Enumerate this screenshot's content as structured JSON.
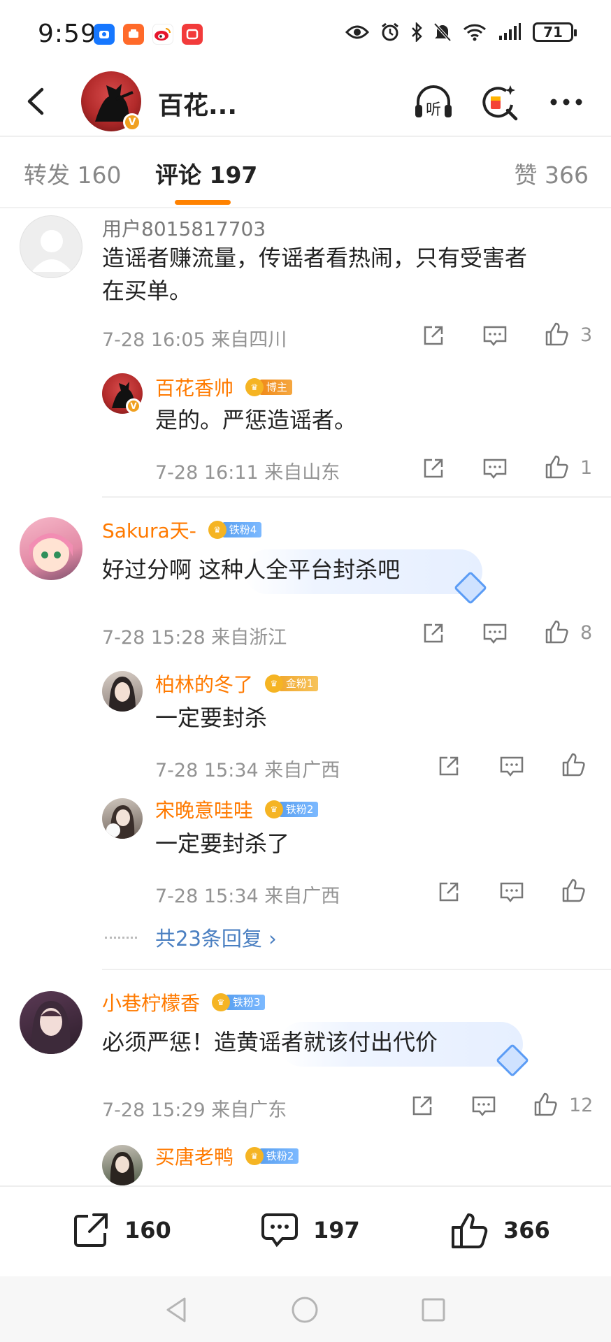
{
  "status_bar": {
    "time": "9:59",
    "battery": "71",
    "app_icons": [
      "app-icon-blue",
      "app-icon-orange",
      "weibo-icon",
      "app-icon-red"
    ],
    "indicators": [
      "eye-icon",
      "alarm-icon",
      "bluetooth-icon",
      "mute-icon",
      "wifi-icon",
      "signal-icon"
    ]
  },
  "header": {
    "title": "百花...",
    "listen_label": "听"
  },
  "tabs": [
    {
      "label": "转发 160"
    },
    {
      "label": "评论 197"
    },
    {
      "label": "赞 366"
    }
  ],
  "comments": [
    {
      "user": "用户8015817703",
      "text_lines": [
        "造谣者赚流量，传谣者看热闹，只有受害者",
        "在买单。"
      ],
      "meta": "7-28 16:05  来自四川",
      "likes": "3",
      "replies": [
        {
          "user": "百花香帅",
          "badge": "博主",
          "text": "是的。严惩造谣者。",
          "meta": "7-28 16:11  来自山东",
          "likes": "1"
        }
      ]
    },
    {
      "user": "Sakura天-",
      "badge": "铁粉4",
      "text": "好过分啊 这种人全平台封杀吧",
      "meta": "7-28 15:28  来自浙江",
      "likes": "8",
      "replies": [
        {
          "user": "柏林的冬了",
          "badge": "金粉1",
          "text": "一定要封杀",
          "meta": "7-28 15:34  来自广西",
          "likes": ""
        },
        {
          "user": "宋晚意哇哇",
          "badge": "铁粉2",
          "text": "一定要封杀了",
          "meta": "7-28 15:34  来自广西",
          "likes": ""
        }
      ],
      "more_replies": "共23条回复 ›"
    },
    {
      "user": "小巷柠檬香",
      "badge": "铁粉3",
      "text": "必须严惩！造黄谣者就该付出代价",
      "meta": "7-28 15:29  来自广东",
      "likes": "12",
      "replies": [
        {
          "user": "买唐老鸭",
          "badge": "铁粉2"
        }
      ]
    }
  ],
  "bottom_bar": {
    "repost_count": "160",
    "comment_count": "197",
    "like_count": "366"
  },
  "colors": {
    "accent": "#ff8200",
    "username": "#ff7a00",
    "link": "#4a7fc1",
    "meta": "#939393"
  }
}
